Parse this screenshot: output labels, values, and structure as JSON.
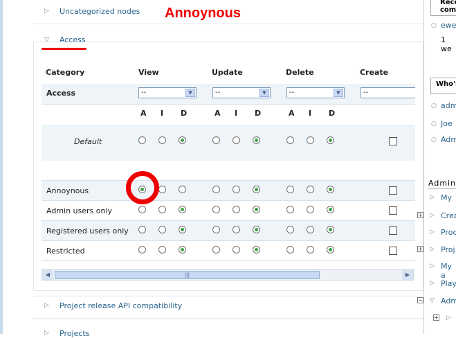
{
  "annotation": {
    "text": "Annoynous",
    "color": "#ef0000"
  },
  "fieldsets": {
    "uncategorized": "Uncategorized nodes",
    "access": "Access",
    "project_release": "Project release API compatibility",
    "projects": "Projects"
  },
  "table": {
    "headers": {
      "category": "Category",
      "view": "View",
      "update": "Update",
      "delete": "Delete",
      "create": "Create"
    },
    "access_row": {
      "label": "Access",
      "select_value": "--"
    },
    "aid": {
      "a": "A",
      "i": "I",
      "d": "D"
    },
    "default_label": "Default",
    "rows": [
      {
        "label": "Annoynous",
        "view": "A",
        "update": "D",
        "delete": "D",
        "create_checked": false
      },
      {
        "label": "Admin users only",
        "view": "D",
        "update": "D",
        "delete": "D",
        "create_checked": false
      },
      {
        "label": "Registered users only",
        "view": "D",
        "update": "D",
        "delete": "D",
        "create_checked": false
      },
      {
        "label": "Restricted",
        "view": "D",
        "update": "D",
        "delete": "D",
        "create_checked": false
      }
    ],
    "scroll_thumb_grip": "|||"
  },
  "sidebar": {
    "recent_head_1": "Rece",
    "recent_head_2": "comm",
    "recent_link": "ewe",
    "recent_time": "1 we",
    "whos_head": "Who's",
    "whos_items": [
      "adm",
      "Joe",
      "Adm"
    ],
    "admin_head": "Admin",
    "admin_items": [
      "My",
      "Crea",
      "Proc",
      "Proj",
      "My a",
      "Play",
      "Adm"
    ],
    "expand_symbol": "+",
    "collapse_symbol": "−"
  },
  "colors": {
    "accent": "#27638c",
    "radio_on": "#43a047",
    "row_band": "#eef4f8"
  },
  "icons": {
    "collapsed": "triangle-right-icon",
    "expanded": "triangle-down-icon",
    "select_arrow": "chevron-down-icon"
  }
}
